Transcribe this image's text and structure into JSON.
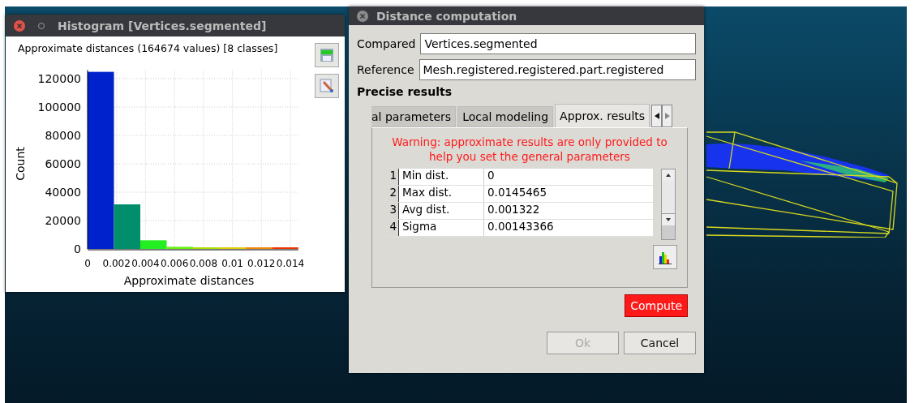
{
  "histogram_window": {
    "title": "Histogram [Vertices.segmented]",
    "chart_data": {
      "type": "bar",
      "title": "Approximate distances (164674 values) [8 classes]",
      "xlabel": "Approximate distances",
      "ylabel": "Count",
      "x": [
        0.00091,
        0.00273,
        0.00455,
        0.00637,
        0.00818,
        0.01,
        0.01182,
        0.01364
      ],
      "series": [
        {
          "colors": [
            "#0022cc",
            "#008f6a",
            "#22ee22",
            "#66ee11",
            "#aadd00",
            "#ddcc00",
            "#ee8800",
            "#ee3300"
          ],
          "values": [
            124800,
            31400,
            6100,
            1500,
            1100,
            700,
            600,
            400
          ]
        }
      ],
      "grid": true,
      "xlim": [
        0,
        0.0145465
      ],
      "ylim": [
        0,
        126000
      ],
      "xticks": [
        0,
        0.002,
        0.004,
        0.006,
        0.008,
        0.01,
        0.012,
        0.014
      ],
      "yticks": [
        0,
        20000,
        40000,
        60000,
        80000,
        100000,
        120000
      ]
    }
  },
  "distance_dialog": {
    "title": "Distance computation",
    "fields": [
      {
        "label": "Compared",
        "value": "Vertices.segmented"
      },
      {
        "label": "Reference",
        "value": "Mesh.registered.registered.part.registered"
      }
    ],
    "section_title": "Precise results",
    "tabs": [
      {
        "label": "al parameters",
        "selected": false
      },
      {
        "label": "Local modeling",
        "selected": false
      },
      {
        "label": "Approx. results",
        "selected": true
      }
    ],
    "warning": "Warning: approximate results are only provided to help you set the general parameters",
    "table_rows": [
      {
        "index": "1",
        "name": "Min dist.",
        "value": "0"
      },
      {
        "index": "2",
        "name": "Max dist.",
        "value": "0.0145465"
      },
      {
        "index": "3",
        "name": "Avg dist.",
        "value": "0.001322"
      },
      {
        "index": "4",
        "name": "Sigma",
        "value": "0.00143366"
      }
    ],
    "compute_button": "Compute",
    "buttons": [
      {
        "label": "Ok",
        "disabled": true
      },
      {
        "label": "Cancel",
        "disabled": false
      }
    ]
  }
}
